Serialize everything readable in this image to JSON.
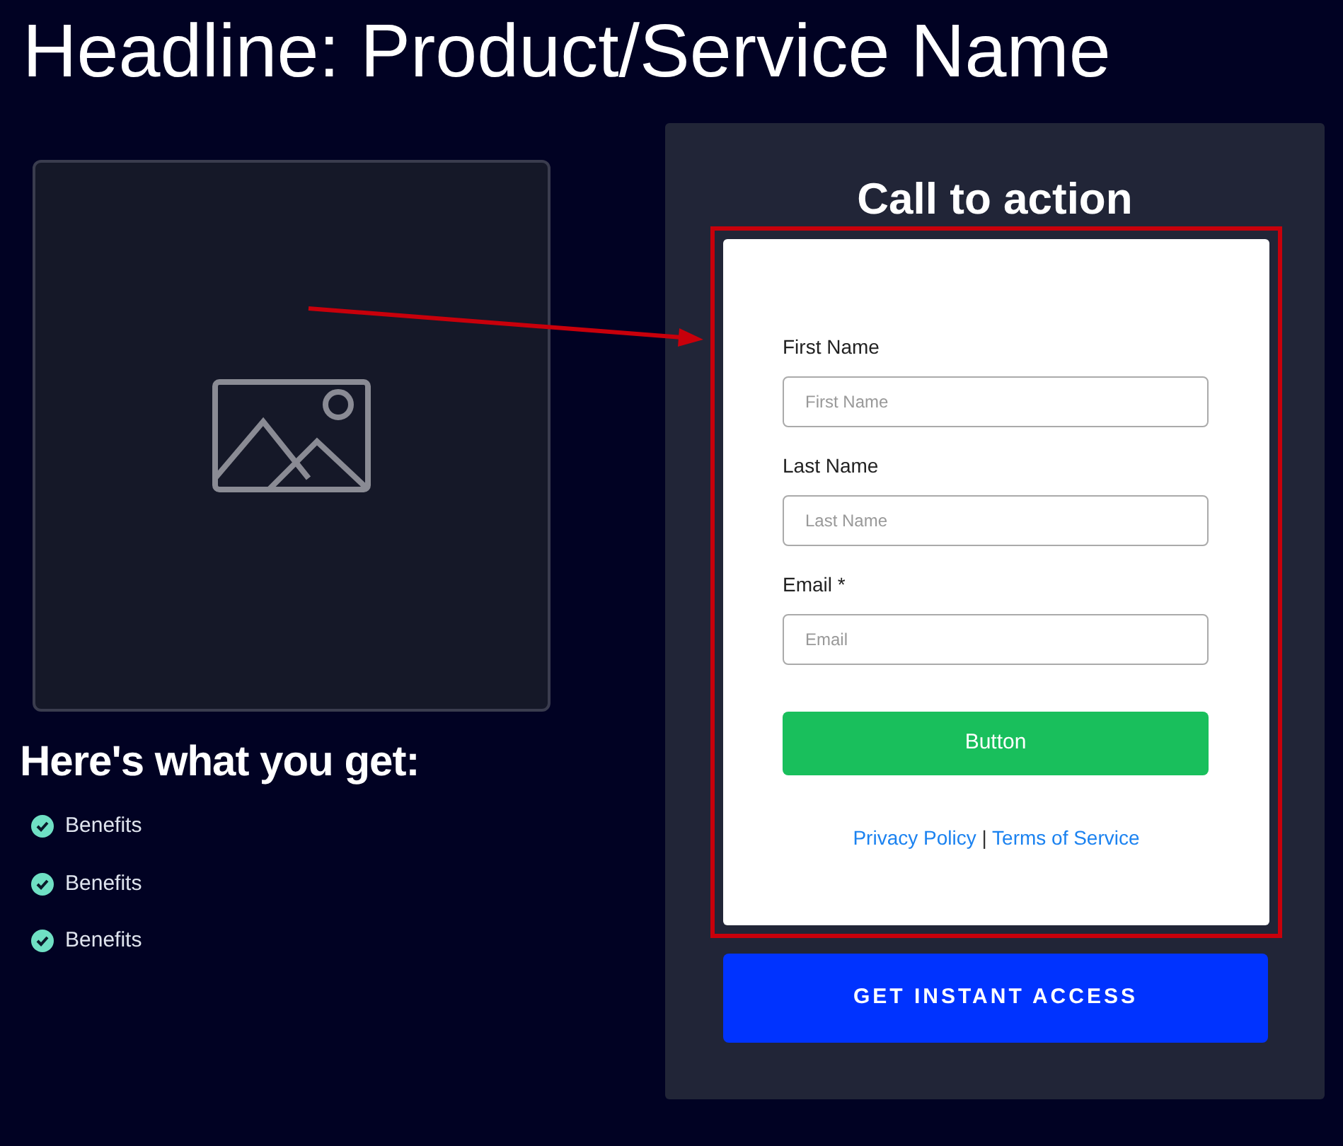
{
  "headline": "Headline: Product/Service Name",
  "benefits_title": "Here's what you get:",
  "benefits": [
    {
      "label": "Benefits"
    },
    {
      "label": "Benefits"
    },
    {
      "label": "Benefits"
    }
  ],
  "panel": {
    "title": "Call to action",
    "form": {
      "fields": [
        {
          "label": "First Name",
          "placeholder": "First Name"
        },
        {
          "label": "Last Name",
          "placeholder": "Last Name"
        },
        {
          "label": "Email *",
          "placeholder": "Email"
        }
      ],
      "submit": "Button",
      "links": [
        {
          "label": "Privacy Policy"
        },
        {
          "label": "Terms of Service"
        }
      ],
      "separator": "|"
    },
    "cta": "GET INSTANT ACCESS"
  }
}
